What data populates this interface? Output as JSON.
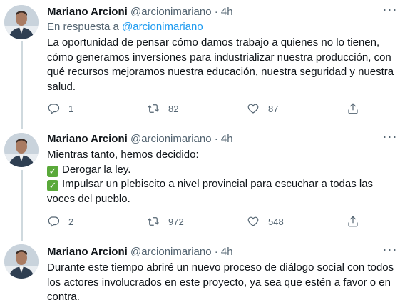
{
  "tweets": [
    {
      "author": "Mariano Arcioni",
      "handle": "@arcionimariano",
      "dot": "·",
      "time": "4h",
      "reply_prefix": "En respuesta a",
      "reply_to": "@arcionimariano",
      "text": "La oportunidad de pensar cómo damos trabajo a quienes no lo tienen, cómo generamos inversiones para industrializar nuestra producción, con qué recursos mejoramos nuestra educación, nuestra seguridad y nuestra salud.",
      "replies": "1",
      "retweets": "82",
      "likes": "87"
    },
    {
      "author": "Mariano Arcioni",
      "handle": "@arcionimariano",
      "dot": "·",
      "time": "4h",
      "text_intro": "Mientras tanto, hemos decidido:",
      "bullet1": "Derogar la ley.",
      "bullet2": "Impulsar un plebiscito a nivel provincial para escuchar a todas las voces del pueblo.",
      "replies": "2",
      "retweets": "972",
      "likes": "548"
    },
    {
      "author": "Mariano Arcioni",
      "handle": "@arcionimariano",
      "dot": "·",
      "time": "4h",
      "text": "Durante este tiempo abriré un nuevo proceso de diálogo social con todos los actores involucrados en este proyecto, ya sea que estén a favor o en contra."
    }
  ],
  "icons": {
    "reply": "reply-icon",
    "retweet": "retweet-icon",
    "like": "heart-icon",
    "share": "share-icon",
    "more": "more-icon",
    "check": "check-mark-button-emoji"
  },
  "colors": {
    "link": "#1d9bf0",
    "secondary_text": "#536471",
    "thread_line": "#cfd9de",
    "check_emoji": "#5aa93a"
  }
}
